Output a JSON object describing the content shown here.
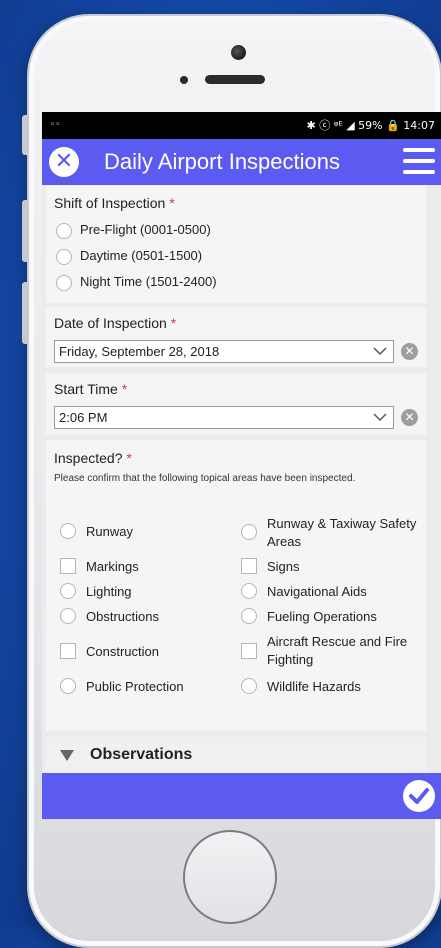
{
  "status_bar": {
    "left": "◦◦",
    "right": "✱ ⓒ ᵠᴱ ◢ 59% 🔒 14:07"
  },
  "header": {
    "title": "Daily Airport Inspections"
  },
  "shift": {
    "label": "Shift of Inspection",
    "required": "*",
    "options": [
      "Pre-Flight (0001-0500)",
      "Daytime (0501-1500)",
      "Night Time (1501-2400)"
    ]
  },
  "date": {
    "label": "Date of Inspection",
    "required": "*",
    "value": "Friday, September 28, 2018"
  },
  "start_time": {
    "label": "Start Time",
    "required": "*",
    "value": "2:06 PM"
  },
  "inspected": {
    "label": "Inspected?",
    "required": "*",
    "help": "Please confirm that the following topical areas have been inspected.",
    "left_items": [
      "Runway",
      "Markings",
      "Lighting",
      "Obstructions",
      "Construction",
      "Public Protection"
    ],
    "right_items": [
      "Runway & Taxiway Safety Areas",
      "Signs",
      "Navigational Aids",
      "Fueling Operations",
      "Aircraft Rescue and Fire Fighting",
      "Wildlife Hazards"
    ]
  },
  "observations": {
    "label": "Observations"
  },
  "colors": {
    "accent": "#5b5bf2",
    "required": "#d43b3b"
  },
  "icons": {
    "close": "close-icon",
    "menu": "hamburger-menu-icon",
    "submit": "checkmark-icon"
  }
}
